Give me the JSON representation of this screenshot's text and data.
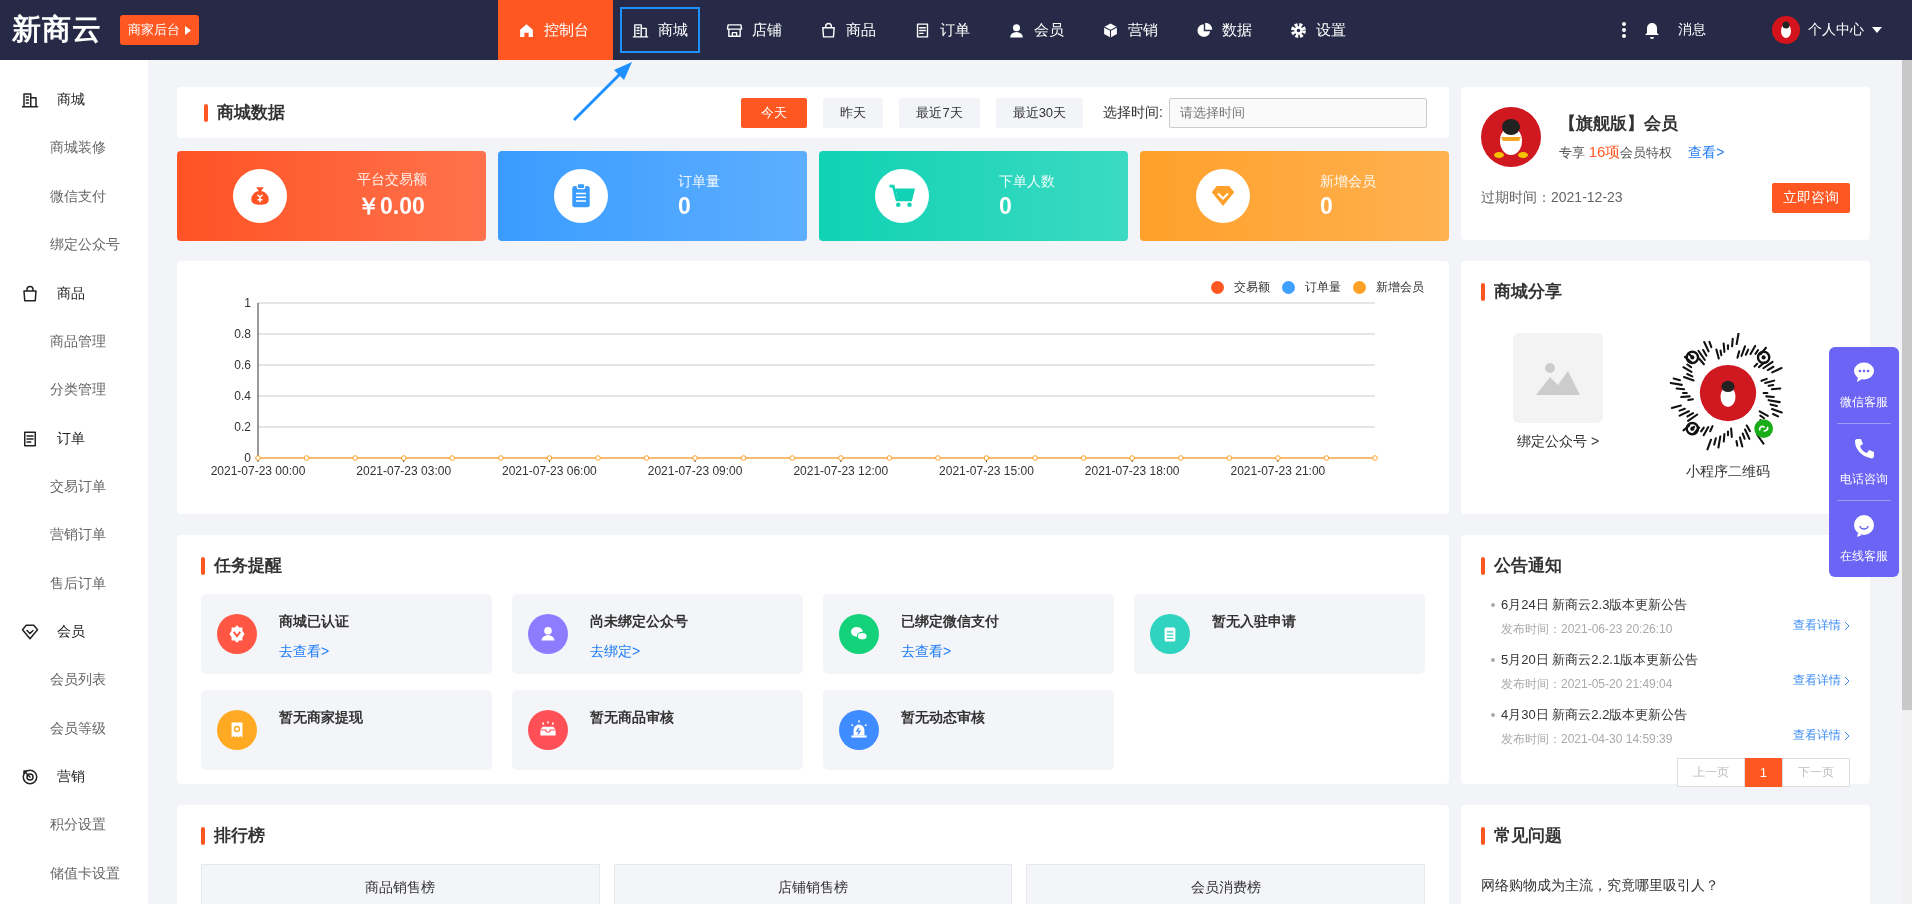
{
  "topbar": {
    "logo": "新商云",
    "backend_button": "商家后台",
    "nav": [
      {
        "label": "控制台",
        "kind": "home",
        "selected": true,
        "highlighted": false
      },
      {
        "label": "商城",
        "kind": "building",
        "selected": false,
        "highlighted": true
      },
      {
        "label": "店铺",
        "kind": "shop",
        "selected": false,
        "highlighted": false
      },
      {
        "label": "商品",
        "kind": "bag",
        "selected": false,
        "highlighted": false
      },
      {
        "label": "订单",
        "kind": "list",
        "selected": false,
        "highlighted": false
      },
      {
        "label": "会员",
        "kind": "user",
        "selected": false,
        "highlighted": false
      },
      {
        "label": "营销",
        "kind": "cube",
        "selected": false,
        "highlighted": false
      },
      {
        "label": "数据",
        "kind": "pie",
        "selected": false,
        "highlighted": false
      },
      {
        "label": "设置",
        "kind": "gear",
        "selected": false,
        "highlighted": false
      }
    ],
    "messages": "消息",
    "account": "个人中心"
  },
  "sidebar": {
    "sections": [
      {
        "title": "商城",
        "kind": "building",
        "children": [
          {
            "label": "商城装修"
          },
          {
            "label": "微信支付"
          },
          {
            "label": "绑定公众号"
          }
        ]
      },
      {
        "title": "商品",
        "kind": "bag",
        "children": [
          {
            "label": "商品管理"
          },
          {
            "label": "分类管理"
          }
        ]
      },
      {
        "title": "订单",
        "kind": "list",
        "children": [
          {
            "label": "交易订单"
          },
          {
            "label": "营销订单"
          },
          {
            "label": "售后订单"
          }
        ]
      },
      {
        "title": "会员",
        "kind": "diamond",
        "children": [
          {
            "label": "会员列表"
          },
          {
            "label": "会员等级"
          }
        ]
      },
      {
        "title": "营销",
        "kind": "target",
        "children": [
          {
            "label": "积分设置"
          },
          {
            "label": "储值卡设置"
          }
        ]
      }
    ]
  },
  "store_data": {
    "title": "商城数据",
    "ranges": [
      {
        "label": "今天",
        "selected": true
      },
      {
        "label": "昨天",
        "selected": false
      },
      {
        "label": "最近7天",
        "selected": false
      },
      {
        "label": "最近30天",
        "selected": false
      }
    ],
    "date_label": "选择时间:",
    "date_placeholder": "请选择时间"
  },
  "stats": [
    {
      "label": "平台交易额",
      "value": "￥0.00",
      "kind": "money",
      "color": "#ff5325"
    },
    {
      "label": "订单量",
      "value": "0",
      "kind": "order",
      "color": "#3a9cff"
    },
    {
      "label": "下单人数",
      "value": "0",
      "kind": "cart",
      "color": "#10d2b4"
    },
    {
      "label": "新增会员",
      "value": "0",
      "kind": "member",
      "color": "#ffa02a"
    }
  ],
  "chart": {
    "chart_data": {
      "type": "line",
      "categories": [
        "2021-07-23 00:00",
        null,
        null,
        "2021-07-23 03:00",
        null,
        null,
        "2021-07-23 06:00",
        null,
        null,
        "2021-07-23 09:00",
        null,
        null,
        "2021-07-23 12:00",
        null,
        null,
        "2021-07-23 15:00",
        null,
        null,
        "2021-07-23 18:00",
        null,
        null,
        "2021-07-23 21:00",
        null,
        null
      ],
      "ylim": [
        0,
        1
      ],
      "yticks": [
        0,
        0.2,
        0.4,
        0.6,
        0.8,
        1
      ],
      "grid": true,
      "legend": true,
      "series": [
        {
          "name": "交易额",
          "color": "#ff5722",
          "marker": "circle",
          "values": [
            null,
            null,
            null,
            null,
            null,
            null,
            null,
            null,
            null,
            null,
            null,
            null,
            null,
            null,
            null,
            null,
            null,
            null,
            null,
            null,
            null,
            null,
            null,
            null
          ]
        },
        {
          "name": "订单量",
          "color": "#3fa0ff",
          "marker": "circle",
          "values": [
            null,
            null,
            null,
            null,
            null,
            null,
            null,
            null,
            null,
            null,
            null,
            null,
            null,
            null,
            null,
            null,
            null,
            null,
            null,
            null,
            null,
            null,
            null,
            null
          ]
        },
        {
          "name": "新增会员",
          "color": "#ffa126",
          "marker": "circle",
          "values": [
            0,
            0,
            0,
            0,
            0,
            0,
            0,
            0,
            0,
            0,
            0,
            0,
            0,
            0,
            0,
            0,
            0,
            0,
            0,
            0,
            0,
            0,
            0,
            0
          ]
        }
      ]
    }
  },
  "tasks": {
    "title": "任务提醒",
    "items": [
      {
        "title": "商城已认证",
        "link": "去查看>",
        "kind": "verified",
        "color": "#ff5744"
      },
      {
        "title": "尚未绑定公众号",
        "link": "去绑定>",
        "kind": "person",
        "color": "#8e7bff"
      },
      {
        "title": "已绑定微信支付",
        "link": "去查看>",
        "kind": "wechat",
        "color": "#14d27a"
      },
      {
        "title": "暂无入驻申请",
        "kind": "clipboard",
        "color": "#2fd3c0"
      },
      {
        "title": "暂无商家提现",
        "kind": "wallet",
        "color": "#ffaa22"
      },
      {
        "title": "暂无商品审核",
        "kind": "box",
        "color": "#ff5058"
      },
      {
        "title": "暂无动态审核",
        "kind": "alarm",
        "color": "#3e8cff"
      }
    ]
  },
  "ranking": {
    "title": "排行榜",
    "columns": [
      "商品销售榜",
      "店铺销售榜",
      "会员消费榜"
    ]
  },
  "membership": {
    "title": "【旗舰版】会员",
    "perk_prefix": "专享 ",
    "perk_count": "16项",
    "perk_suffix": "会员特权",
    "view_link": "查看>",
    "expiry": "过期时间：2021-12-23",
    "consult_button": "立即咨询"
  },
  "share": {
    "title": "商城分享",
    "items": [
      {
        "label": "绑定公众号 >",
        "kind": "image"
      },
      {
        "label": "小程序二维码",
        "kind": "qr"
      }
    ]
  },
  "notices": {
    "title": "公告通知",
    "items": [
      {
        "title": "6月24日 新商云2.3版本更新公告",
        "time": "发布时间：2021-06-23 20:26:10",
        "link": "查看详情"
      },
      {
        "title": "5月20日 新商云2.2.1版本更新公告",
        "time": "发布时间：2021-05-20 21:49:04",
        "link": "查看详情"
      },
      {
        "title": "4月30日 新商云2.2版本更新公告",
        "time": "发布时间：2021-04-30 14:59:39",
        "link": "查看详情"
      }
    ],
    "pagination": {
      "prev": {
        "label": "上一页",
        "disabled": true
      },
      "pages": [
        {
          "label": "1",
          "selected": true
        }
      ],
      "next": {
        "label": "下一页",
        "disabled": true
      }
    }
  },
  "faq": {
    "title": "常见问题",
    "items": [
      "网络购物成为主流，究竟哪里吸引人？"
    ]
  },
  "float_service": [
    {
      "label": "微信客服",
      "kind": "wechat"
    },
    {
      "label": "电话咨询",
      "kind": "phone"
    },
    {
      "label": "在线客服",
      "kind": "chat"
    }
  ]
}
